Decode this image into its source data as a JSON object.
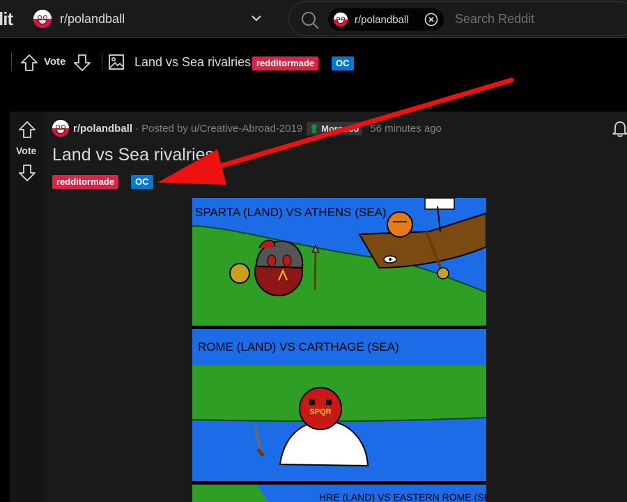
{
  "header": {
    "logo_fragment": "lit",
    "community": "r/polandball",
    "search": {
      "chip_label": "r/polandball",
      "placeholder": "Search Reddit"
    }
  },
  "sticky_bar": {
    "vote_label": "Vote",
    "title": "Land vs Sea rivalries",
    "flairs": [
      "redditormade",
      "OC"
    ]
  },
  "post": {
    "subreddit": "r/polandball",
    "posted_by": "· Posted by u/Creative-Abroad-2019",
    "user_flair": "Morocco",
    "time": "56 minutes ago",
    "vote_label": "Vote",
    "title": "Land vs Sea rivalries",
    "flairs": [
      "redditormade",
      "OC"
    ]
  },
  "comic": {
    "panel1_caption": "SPARTA (LAND) VS ATHENS (SEA)",
    "panel2_caption": "ROME (LAND) VS CARTHAGE (SEA)",
    "panel3_caption": "HRE (LAND) VS EASTERN ROME (SEA)",
    "spqr_text": "SPQR"
  },
  "colors": {
    "flair_red": "#dc2245",
    "flair_blue": "#0079d3",
    "annotation_arrow": "#ee1111"
  }
}
